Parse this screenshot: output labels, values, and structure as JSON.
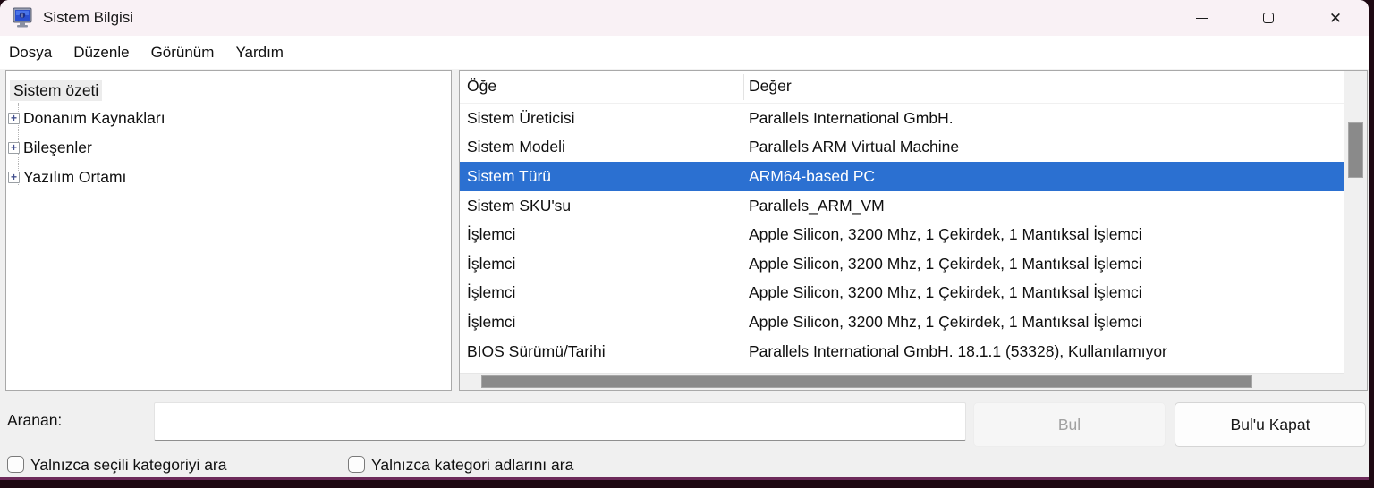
{
  "window": {
    "title": "Sistem Bilgisi",
    "close_glyph": "✕"
  },
  "menu": {
    "file": "Dosya",
    "edit": "Düzenle",
    "view": "Görünüm",
    "help": "Yardım"
  },
  "tree": {
    "root": "Sistem özeti",
    "expander_glyph": "+",
    "items": [
      {
        "label": "Donanım Kaynakları"
      },
      {
        "label": "Bileşenler"
      },
      {
        "label": "Yazılım Ortamı"
      }
    ]
  },
  "list": {
    "columns": {
      "item": "Öğe",
      "value": "Değer"
    },
    "rows": [
      {
        "item": "Sistem Üreticisi",
        "value": "Parallels International GmbH."
      },
      {
        "item": "Sistem Modeli",
        "value": "Parallels ARM Virtual Machine"
      },
      {
        "item": "Sistem Türü",
        "value": "ARM64-based PC",
        "selected": true
      },
      {
        "item": "Sistem SKU'su",
        "value": "Parallels_ARM_VM"
      },
      {
        "item": "İşlemci",
        "value": "Apple Silicon, 3200 Mhz, 1 Çekirdek, 1 Mantıksal İşlemci"
      },
      {
        "item": "İşlemci",
        "value": "Apple Silicon, 3200 Mhz, 1 Çekirdek, 1 Mantıksal İşlemci"
      },
      {
        "item": "İşlemci",
        "value": "Apple Silicon, 3200 Mhz, 1 Çekirdek, 1 Mantıksal İşlemci"
      },
      {
        "item": "İşlemci",
        "value": "Apple Silicon, 3200 Mhz, 1 Çekirdek, 1 Mantıksal İşlemci"
      },
      {
        "item": "BIOS Sürümü/Tarihi",
        "value": "Parallels International GmbH. 18.1.1 (53328), Kullanılamıyor"
      }
    ]
  },
  "search": {
    "label": "Aranan:",
    "input_value": "",
    "find_button": "Bul",
    "close_find_button": "Bul'u Kapat",
    "checkbox_selected_category": "Yalnızca seçili kategoriyi ara",
    "checkbox_category_names": "Yalnızca kategori adlarını ara"
  },
  "colors": {
    "selection_blue": "#2b70d1",
    "titlebar_pink": "#f9f1f5",
    "window_gray": "#f0f0f0",
    "scroll_thumb": "#8a8a8a",
    "window_edge": "#6d2a5a"
  }
}
